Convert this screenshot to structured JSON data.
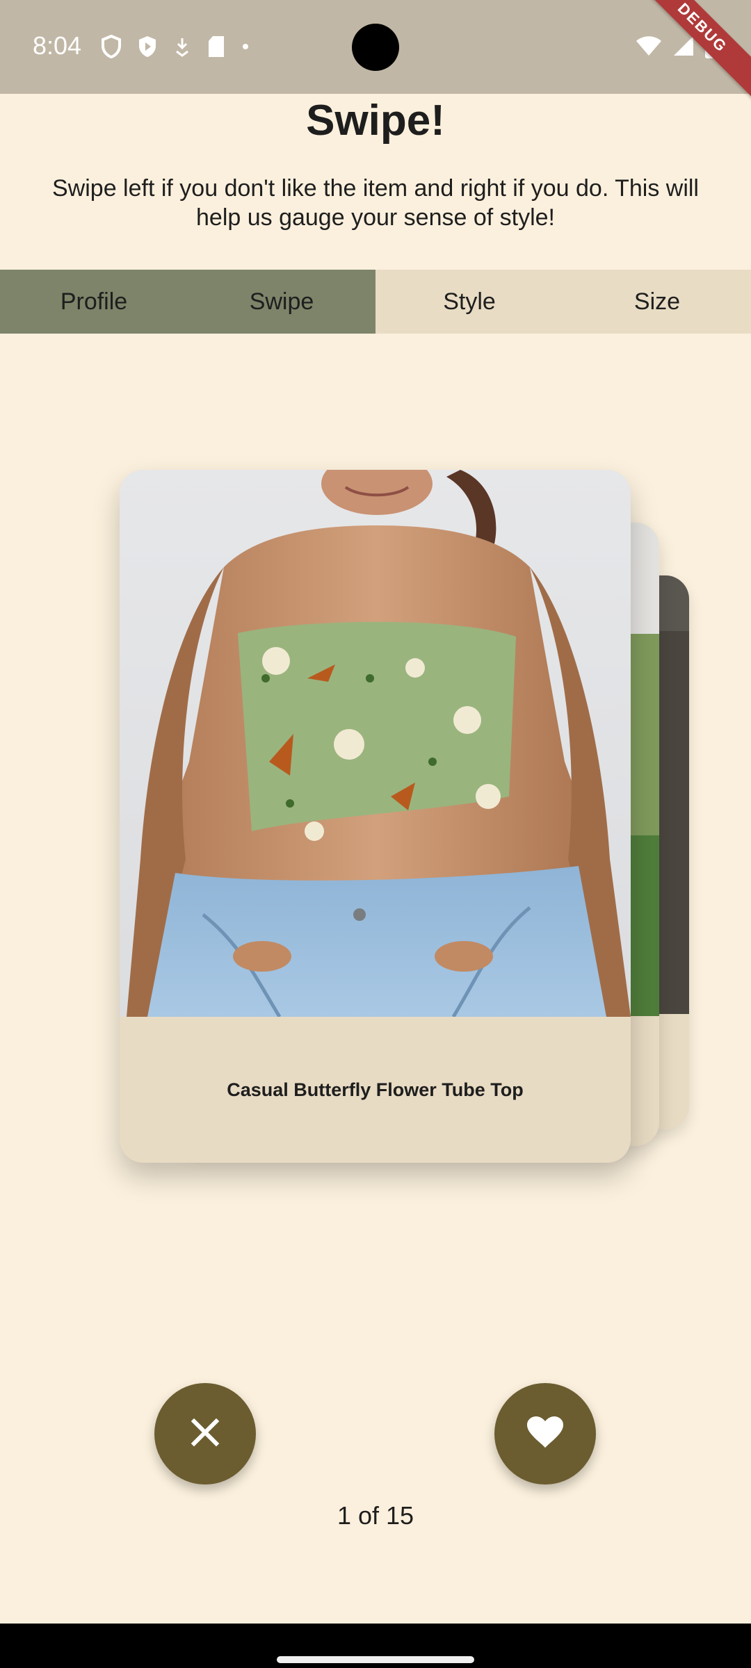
{
  "status_bar": {
    "time": "8:04",
    "left_icons": [
      "shield-icon",
      "play-protect-icon",
      "download-icon",
      "sd-card-icon",
      "dot-icon"
    ],
    "right_icons": [
      "wifi-icon",
      "signal-icon",
      "battery-icon"
    ],
    "debug_label": "DEBUG"
  },
  "header": {
    "title": "Swipe!",
    "subtitle": "Swipe left if you don't like the item and right if you do. This will help us gauge your sense of style!"
  },
  "tabs": [
    {
      "label": "Profile",
      "active": true
    },
    {
      "label": "Swipe",
      "active": true
    },
    {
      "label": "Style",
      "active": false
    },
    {
      "label": "Size",
      "active": false
    }
  ],
  "cards": {
    "front": {
      "title": "Casual Butterfly Flower Tube Top"
    }
  },
  "actions": {
    "dislike_icon": "close-icon",
    "like_icon": "heart-icon"
  },
  "counter": "1 of 15",
  "colors": {
    "background": "#fbf0dd",
    "status_bar": "#c1b7a6",
    "tab_active": "#7d8469",
    "tab_inactive": "#e8dcc4",
    "card": "#e8dbc3",
    "button": "#6b5d30"
  }
}
